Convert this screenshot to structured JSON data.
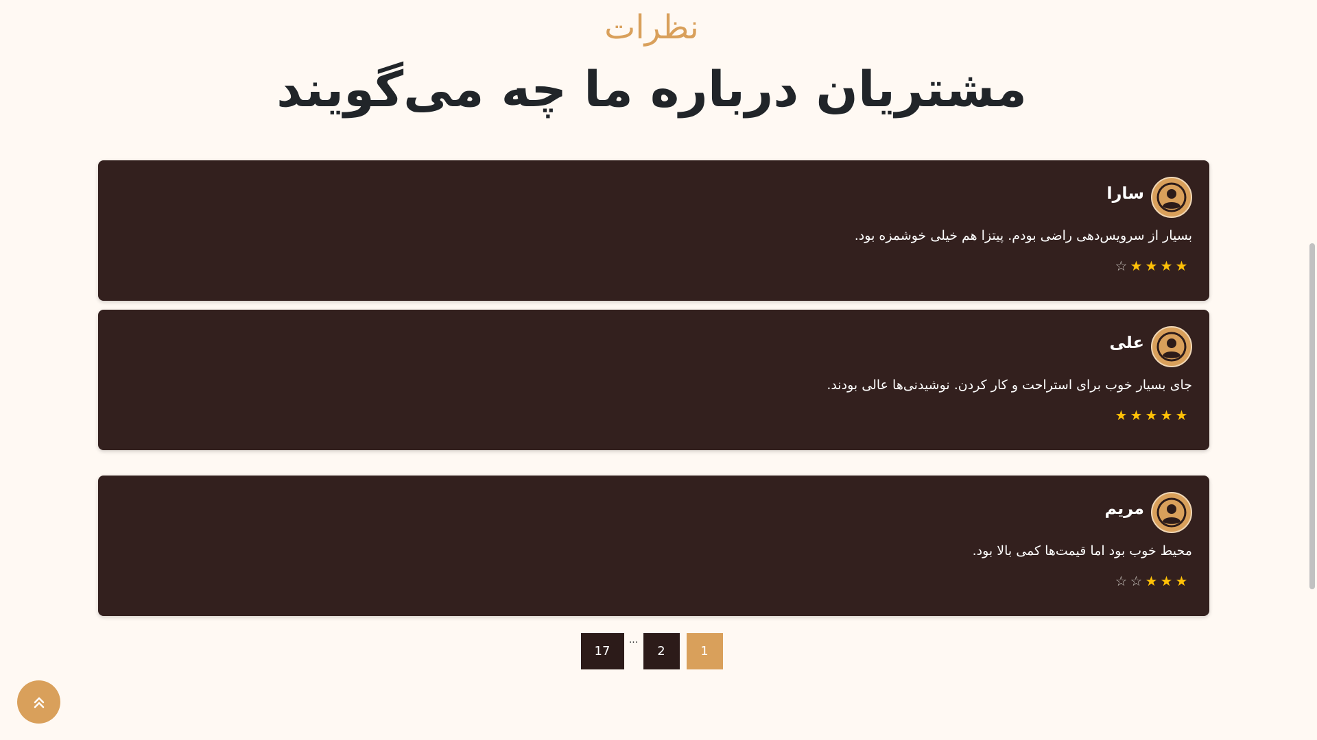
{
  "header": {
    "subtitle": "نظرات",
    "title": "مشتریان درباره ما چه می‌گویند"
  },
  "reviews": [
    {
      "name": "سارا",
      "text": "بسیار از سرویس‌دهی راضی بودم. پیتزا هم خیلی خوشمزه بود.",
      "rating": 4,
      "max_rating": 5,
      "avatar_icon": "user-circle-icon"
    },
    {
      "name": "علی",
      "text": "جای بسیار خوب برای استراحت و کار کردن. نوشیدنی‌ها عالی بودند.",
      "rating": 5,
      "max_rating": 5,
      "avatar_icon": "user-circle-icon"
    },
    {
      "name": "مریم",
      "text": "محیط خوب بود اما قیمت‌ها کمی بالا بود.",
      "rating": 3,
      "max_rating": 5,
      "avatar_icon": "user-circle-icon"
    }
  ],
  "pagination": {
    "last_page": "17",
    "ellipsis": "...",
    "page_2": "2",
    "current_page": "1"
  },
  "back_to_top": {
    "icon": "double-chevron-up-icon"
  },
  "colors": {
    "accent": "#d9a05b",
    "card_background": "#33201e",
    "page_background": "#fff9f3",
    "star_filled": "#ffc107",
    "title_text": "#212529"
  }
}
